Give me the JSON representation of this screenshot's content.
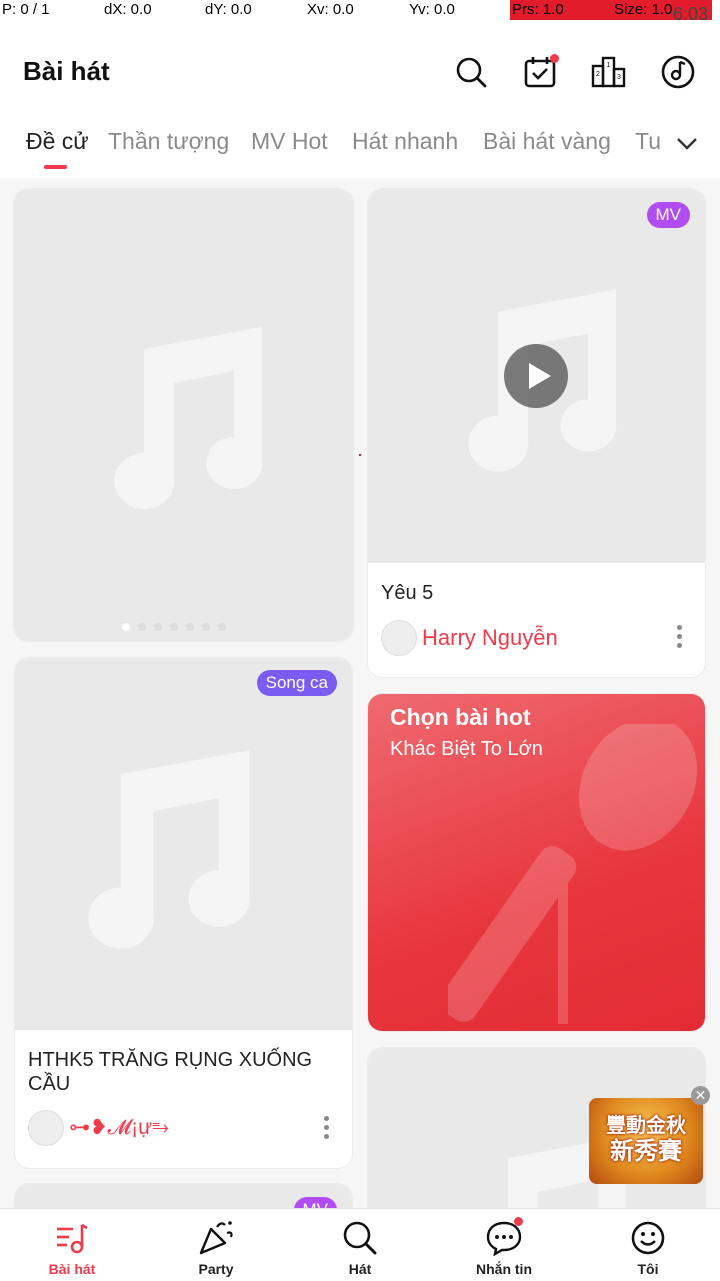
{
  "debug": {
    "p": "P: 0 / 1",
    "dx": "dX: 0.0",
    "dy": "dY: 0.0",
    "xv": "Xv: 0.0",
    "yv": "Yv: 0.0",
    "prs": "Prs: 1.0",
    "size": "Size: 1.0",
    "time": "6:03"
  },
  "header": {
    "title": "Bài hát",
    "icons": [
      "search-icon",
      "calendar-check-icon",
      "leaderboard-icon",
      "music-disc-icon"
    ]
  },
  "tabs": [
    {
      "label": "Đề cử",
      "active": true
    },
    {
      "label": "Thần tượng",
      "active": false
    },
    {
      "label": "MV Hot",
      "active": false
    },
    {
      "label": "Hát nhanh",
      "active": false
    },
    {
      "label": "Bài hát vàng",
      "active": false
    },
    {
      "label": "Tu",
      "active": false
    }
  ],
  "feed": {
    "card_yeu5": {
      "badge": "MV",
      "title": "Yêu 5",
      "user": "Harry Nguyễn"
    },
    "card_hthk5": {
      "badge": "Song ca",
      "title": "HTHK5 TRĂNG RỤNG XUỐNG CẦU",
      "user": "⊶❥𝓜¡ự⥱"
    },
    "hot_card": {
      "title": "Chọn bài hot",
      "subtitle": "Khác Biệt To Lớn"
    },
    "bottom_left_badge": "MV"
  },
  "promo": {
    "line1": "豐動金秋",
    "line2": "新秀賽"
  },
  "nav": [
    {
      "label": "Bài hát",
      "icon": "song-list-icon",
      "active": true
    },
    {
      "label": "Party",
      "icon": "party-popper-icon",
      "active": false
    },
    {
      "label": "Hát",
      "icon": "sing-search-icon",
      "active": false
    },
    {
      "label": "Nhắn tin",
      "icon": "chat-bubble-icon",
      "active": false
    },
    {
      "label": "Tôi",
      "icon": "smiley-icon",
      "active": false
    }
  ],
  "colors": {
    "accent": "#ef3b4b",
    "mv_badge": "#b14cf0",
    "duet_badge": "#7b5cf2"
  }
}
